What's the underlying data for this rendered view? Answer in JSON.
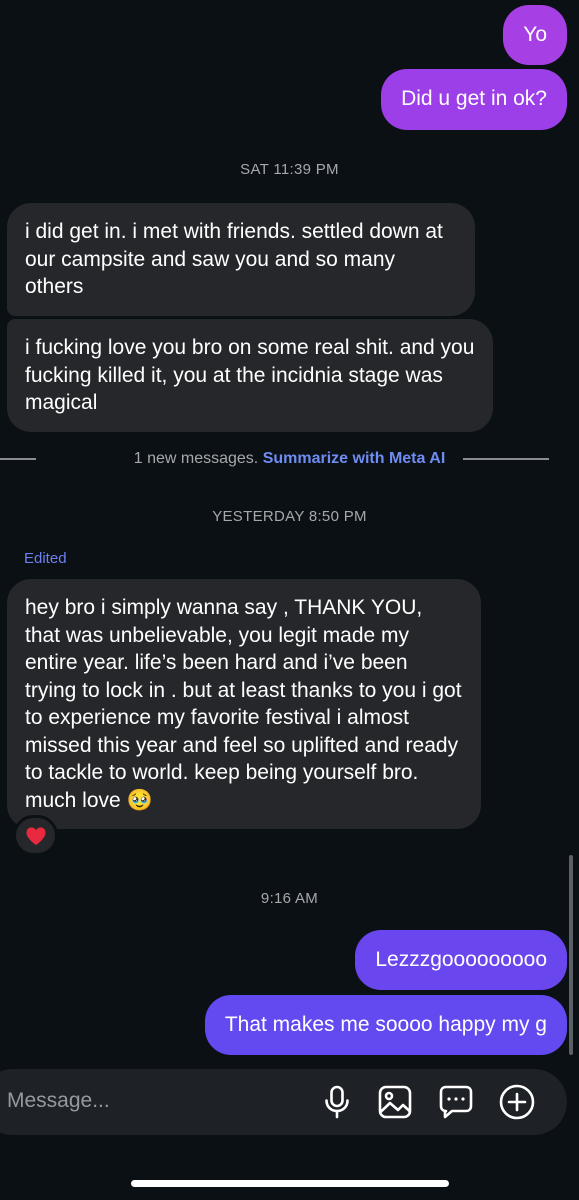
{
  "messages": {
    "sent_1": "Yo",
    "sent_2": "Did u get in ok?",
    "ts_1": "SAT 11:39 PM",
    "recv_1": "i did get in. i met with friends. settled down at our campsite and saw you and so many others",
    "recv_2": "i fucking love you bro on some real shit. and you fucking killed it, you at the incidnia stage was magical",
    "ts_2": "YESTERDAY 8:50 PM",
    "edited_label": "Edited",
    "recv_3": "hey bro i simply wanna say , THANK YOU, that was unbelievable, you legit made my entire year. life’s been hard and i’ve been trying to lock in . but at least thanks to you i got to experience my favorite festival i almost missed this year and feel so uplifted and ready to tackle to world. keep being yourself bro. much love",
    "recv_3_emoji": "🥹",
    "reaction": "❤️",
    "ts_3": "9:16 AM",
    "sent_3": "Lezzzgooooooooo",
    "sent_4": "That makes me soooo happy my g"
  },
  "divider": {
    "text": "1 new messages.",
    "link": "Summarize with Meta AI"
  },
  "composer": {
    "placeholder": "Message...",
    "icons": [
      "microphone-icon",
      "image-icon",
      "sticker-message-icon",
      "plus-icon"
    ]
  },
  "colors": {
    "background": "#0b1014",
    "received_bubble": "#25272b",
    "sent_gradient_top": "#a742e6",
    "sent_gradient_bottom": "#6247f0",
    "accent_link": "#6e8cf2"
  }
}
